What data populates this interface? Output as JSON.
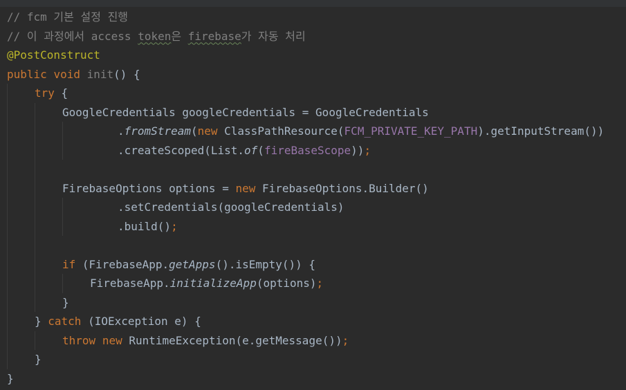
{
  "lines": [
    [
      "// fcm 기본 설정 진행"
    ],
    [
      "// 이 과정에서 access ",
      "token",
      "은 ",
      "firebase",
      "가 자동 처리"
    ],
    [
      "@PostConstruct"
    ],
    [
      "public",
      " ",
      "void",
      " ",
      "init",
      "() {"
    ],
    [
      "try",
      " {"
    ],
    [
      "GoogleCredentials googleCredentials = GoogleCredentials"
    ],
    [
      ".",
      "fromStream",
      "(",
      "new",
      " ClassPathResource(",
      "FCM_PRIVATE_KEY_PATH",
      ").getInputStream())"
    ],
    [
      ".createScoped(List.",
      "of",
      "(",
      "fireBaseScope",
      "))",
      ";"
    ],
    [
      ""
    ],
    [
      "FirebaseOptions options = ",
      "new",
      " FirebaseOptions.Builder()"
    ],
    [
      ".setCredentials(googleCredentials)"
    ],
    [
      ".build()",
      ";"
    ],
    [
      ""
    ],
    [
      "if",
      " (FirebaseApp.",
      "getApps",
      "().isEmpty()) {"
    ],
    [
      "FirebaseApp.",
      "initializeApp",
      "(options)",
      ";"
    ],
    [
      "}"
    ],
    [
      "} ",
      "catch",
      " (IOException e) {"
    ],
    [
      "throw",
      " ",
      "new",
      " RuntimeException(e.getMessage())",
      ";"
    ],
    [
      "}"
    ],
    [
      "}"
    ]
  ]
}
